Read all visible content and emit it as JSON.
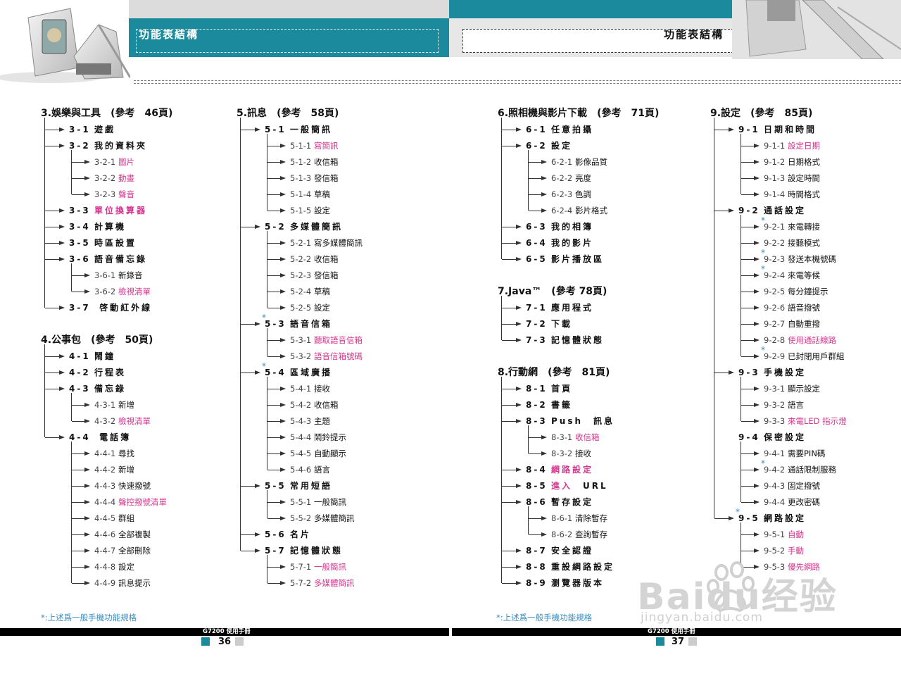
{
  "header": {
    "left_title": "功能表結構",
    "right_title": "功能表結構"
  },
  "left_page": {
    "col1": [
      {
        "title": "3.娛樂與工具",
        "ref": "(參考　46頁)",
        "items": [
          {
            "code": "3-1",
            "label": "遊戲"
          },
          {
            "code": "3-2",
            "label": "我的資料夾",
            "children": [
              {
                "code": "3-2-1",
                "label": "圖片",
                "pink": true
              },
              {
                "code": "3-2-2",
                "label": "動畫",
                "pink": true
              },
              {
                "code": "3-2-3",
                "label": "聲音",
                "pink": true
              }
            ]
          },
          {
            "code": "3-3",
            "label": "單位換算器",
            "pink": true
          },
          {
            "code": "3-4",
            "label": "計算機"
          },
          {
            "code": "3-5",
            "label": "時區設置"
          },
          {
            "code": "3-6",
            "label": "語音備忘錄",
            "children": [
              {
                "code": "3-6-1",
                "label": "新錄音"
              },
              {
                "code": "3-6-2",
                "label": "檢視清單",
                "pink": true
              }
            ]
          },
          {
            "code": "3-7",
            "label": " 啓動紅外線"
          }
        ]
      },
      {
        "title": "4.公事包",
        "ref": "(參考　50頁)",
        "items": [
          {
            "code": "4-1",
            "label": "鬧鐘"
          },
          {
            "code": "4-2",
            "label": "行程表"
          },
          {
            "code": "4-3",
            "label": "備忘錄",
            "children": [
              {
                "code": "4-3-1",
                "label": "新增"
              },
              {
                "code": "4-3-2",
                "label": "檢視清單",
                "pink": true
              }
            ]
          },
          {
            "code": "4-4",
            "label": " 電話簿",
            "children": [
              {
                "code": "4-4-1",
                "label": "尋找"
              },
              {
                "code": "4-4-2",
                "label": "新增"
              },
              {
                "code": "4-4-3",
                "label": "快速撥號"
              },
              {
                "code": "4-4-4",
                "label": "聲控撥號清單",
                "pink": true
              },
              {
                "code": "4-4-5",
                "label": "群組"
              },
              {
                "code": "4-4-6",
                "label": "全部複製"
              },
              {
                "code": "4-4-7",
                "label": "全部刪除"
              },
              {
                "code": "4-4-8",
                "label": "設定"
              },
              {
                "code": "4-4-9",
                "label": "訊息提示"
              }
            ]
          }
        ]
      }
    ],
    "col2": [
      {
        "title": "5.訊息",
        "ref": "(參考　58頁)",
        "items": [
          {
            "code": "5-1",
            "label": "一般簡訊",
            "children": [
              {
                "code": "5-1-1",
                "label": "寫簡訊",
                "pink": true
              },
              {
                "code": "5-1-2",
                "label": "收信箱"
              },
              {
                "code": "5-1-3",
                "label": "發信箱"
              },
              {
                "code": "5-1-4",
                "label": "草稿"
              },
              {
                "code": "5-1-5",
                "label": "設定"
              }
            ]
          },
          {
            "code": "5-2",
            "label": "多媒體簡訊",
            "children": [
              {
                "code": "5-2-1",
                "label": "寫多媒體簡訊"
              },
              {
                "code": "5-2-2",
                "label": "收信箱"
              },
              {
                "code": "5-2-3",
                "label": "發信箱"
              },
              {
                "code": "5-2-4",
                "label": "草稿"
              },
              {
                "code": "5-2-5",
                "label": "設定"
              }
            ]
          },
          {
            "code": "5-3",
            "label": "語音信箱",
            "star": true,
            "children": [
              {
                "code": "5-3-1",
                "label": "聽取語音信箱",
                "pink": true
              },
              {
                "code": "5-3-2",
                "label": "語音信箱號碼",
                "pink": true
              }
            ]
          },
          {
            "code": "5-4",
            "label": "區域廣播",
            "star": true,
            "children": [
              {
                "code": "5-4-1",
                "label": "接收"
              },
              {
                "code": "5-4-2",
                "label": "收信箱"
              },
              {
                "code": "5-4-3",
                "label": "主題"
              },
              {
                "code": "5-4-4",
                "label": "鬧鈴提示"
              },
              {
                "code": "5-4-5",
                "label": "自動顯示"
              },
              {
                "code": "5-4-6",
                "label": "語言"
              }
            ]
          },
          {
            "code": "5-5",
            "label": "常用短語",
            "children": [
              {
                "code": "5-5-1",
                "label": "一般簡訊"
              },
              {
                "code": "5-5-2",
                "label": "多媒體簡訊"
              }
            ]
          },
          {
            "code": "5-6",
            "label": "名片"
          },
          {
            "code": "5-7",
            "label": "記憶體狀態",
            "children": [
              {
                "code": "5-7-1",
                "label": "一般簡訊",
                "pink": true
              },
              {
                "code": "5-7-2",
                "label": "多媒體簡訊",
                "pink": true
              }
            ]
          }
        ]
      }
    ],
    "footnote": "*:上述爲一般手機功能規格",
    "footer_label": "G7200 使用手冊",
    "page_number": "36"
  },
  "right_page": {
    "col1": [
      {
        "title": "6.照相機與影片下載",
        "ref": "(參考　71頁)",
        "items": [
          {
            "code": "6-1",
            "label": "任意拍攝"
          },
          {
            "code": "6-2",
            "label": "設定",
            "children": [
              {
                "code": "6-2-1",
                "label": "影像品質"
              },
              {
                "code": "6-2-2",
                "label": "亮度"
              },
              {
                "code": "6-2-3",
                "label": "色調"
              },
              {
                "code": "6-2-4",
                "label": "影片格式"
              }
            ]
          },
          {
            "code": "6-3",
            "label": "我的相簿"
          },
          {
            "code": "6-4",
            "label": "我的影片"
          },
          {
            "code": "6-5",
            "label": "影片播放區"
          }
        ]
      },
      {
        "title": "7.Java™",
        "ref": "(參考 78頁)",
        "items": [
          {
            "code": "7-1",
            "label": "應用程式"
          },
          {
            "code": "7-2",
            "label": "下載"
          },
          {
            "code": "7-3",
            "label": "記憶體狀態"
          }
        ]
      },
      {
        "title": "8.行動網",
        "ref": "(參考　81頁)",
        "items": [
          {
            "code": "8-1",
            "label": "首頁"
          },
          {
            "code": "8-2",
            "label": "書籤"
          },
          {
            "code": "8-3",
            "label": "Push　訊息",
            "children": [
              {
                "code": "8-3-1",
                "label": "收信箱",
                "pink": true
              },
              {
                "code": "8-3-2",
                "label": "接收"
              }
            ]
          },
          {
            "code": "8-4",
            "label": "網路設定",
            "pink": true
          },
          {
            "code": "8-5",
            "label": "進入　URL",
            "pinkPart": "進入"
          },
          {
            "code": "8-6",
            "label": "暫存設定",
            "children": [
              {
                "code": "8-6-1",
                "label": "清除暫存"
              },
              {
                "code": "8-6-2",
                "label": "查詢暫存"
              }
            ]
          },
          {
            "code": "8-7",
            "label": "安全認證"
          },
          {
            "code": "8-8",
            "label": "重設網路設定"
          },
          {
            "code": "8-9",
            "label": "瀏覽器版本"
          }
        ]
      }
    ],
    "col2": [
      {
        "title": "9.設定",
        "ref": "(參考　85頁)",
        "items": [
          {
            "code": "9-1",
            "label": "日期和時間",
            "children": [
              {
                "code": "9-1-1",
                "label": "設定日期",
                "pink": true
              },
              {
                "code": "9-1-2",
                "label": "日期格式"
              },
              {
                "code": "9-1-3",
                "label": "設定時間"
              },
              {
                "code": "9-1-4",
                "label": "時間格式"
              }
            ]
          },
          {
            "code": "9-2",
            "label": "通話設定",
            "children": [
              {
                "code": "9-2-1",
                "label": "來電轉接",
                "star": true
              },
              {
                "code": "9-2-2",
                "label": "接聽模式"
              },
              {
                "code": "9-2-3",
                "label": "發送本機號碼",
                "star": true
              },
              {
                "code": "9-2-4",
                "label": "來電等候",
                "star": true
              },
              {
                "code": "9-2-5",
                "label": "每分鐘提示"
              },
              {
                "code": "9-2-6",
                "label": "語音撥號"
              },
              {
                "code": "9-2-7",
                "label": "自動重撥"
              },
              {
                "code": "9-2-8",
                "label": "使用通話線路",
                "pink": true
              },
              {
                "code": "9-2-9",
                "label": "已封閉用戶群組",
                "star": true
              }
            ]
          },
          {
            "code": "9-3",
            "label": "手機設定",
            "children": [
              {
                "code": "9-3-1",
                "label": "顯示設定"
              },
              {
                "code": "9-3-2",
                "label": "語言"
              },
              {
                "code": "9-3-3",
                "label": "來電LED 指示燈",
                "pink": true
              }
            ]
          },
          {
            "code": "9-4",
            "label": "保密設定",
            "noArrow": true,
            "children": [
              {
                "code": "9-4-1",
                "label": "需要PIN碼"
              },
              {
                "code": "9-4-2",
                "label": "通話限制服務",
                "star": true
              },
              {
                "code": "9-4-3",
                "label": "固定撥號"
              },
              {
                "code": "9-4-4",
                "label": "更改密碼"
              }
            ]
          },
          {
            "code": "9-5",
            "label": "網路設定",
            "star": true,
            "children": [
              {
                "code": "9-5-1",
                "label": "自動",
                "pink": true
              },
              {
                "code": "9-5-2",
                "label": "手動",
                "pink": true
              },
              {
                "code": "9-5-3",
                "label": "優先網路",
                "pink": true
              }
            ]
          }
        ]
      }
    ],
    "footnote": "*:上述爲一般手機功能規格",
    "footer_label": "G7200 使用手冊",
    "page_number": "37"
  },
  "watermark": {
    "logo": "Baidu经验",
    "url": "jingyan.baidu.com"
  },
  "colors": {
    "teal": "#1a8a9c",
    "pink": "#d4358e",
    "star_blue": "#3a8ec0"
  }
}
